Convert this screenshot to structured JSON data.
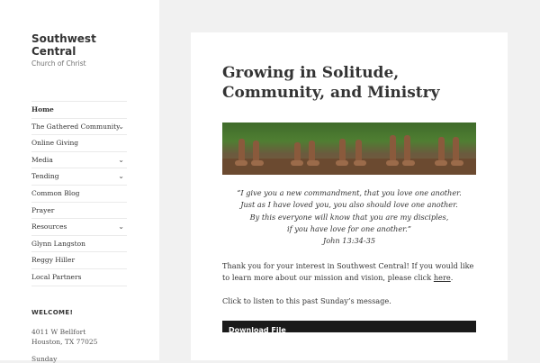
{
  "site": {
    "title": "Southwest Central",
    "description": "Church of Christ"
  },
  "nav": {
    "items": [
      {
        "label": "Home",
        "has_children": false
      },
      {
        "label": "The Gathered Community",
        "has_children": true
      },
      {
        "label": "Online Giving",
        "has_children": false
      },
      {
        "label": "Media",
        "has_children": true
      },
      {
        "label": "Tending",
        "has_children": true
      },
      {
        "label": "Common Blog",
        "has_children": false
      },
      {
        "label": "Prayer",
        "has_children": false
      },
      {
        "label": "Resources",
        "has_children": true
      },
      {
        "label": "Glynn Langston",
        "has_children": false
      },
      {
        "label": "Reggy Hiller",
        "has_children": false
      },
      {
        "label": "Local Partners",
        "has_children": false
      }
    ],
    "chevron_icon": "chevron-down-icon"
  },
  "widget": {
    "title": "WELCOME!",
    "address_line1": "4011 W Bellfort",
    "address_line2": "Houston, TX 77025",
    "sunday": "Sunday"
  },
  "post": {
    "title": "Growing in Solitude, Community, and Ministry",
    "quote": [
      "“I give you a new commandment, that you love one another.",
      "Just as I have loved you, you also should love one another.",
      "By this everyone will know that you are my disciples,",
      "if you have love for one another.”",
      "John 13:34-35"
    ],
    "intro_text": "Thank you for your interest in Southwest Central! If you would like to learn more about our mission and vision, please click ",
    "intro_link": "here",
    "intro_end": ".",
    "listen_text": "Click to listen to this past Sunday’s message.",
    "download_label": "Download File"
  },
  "colors": {
    "page_bg": "#f1f1f1",
    "card_bg": "#ffffff",
    "text": "#333333"
  }
}
